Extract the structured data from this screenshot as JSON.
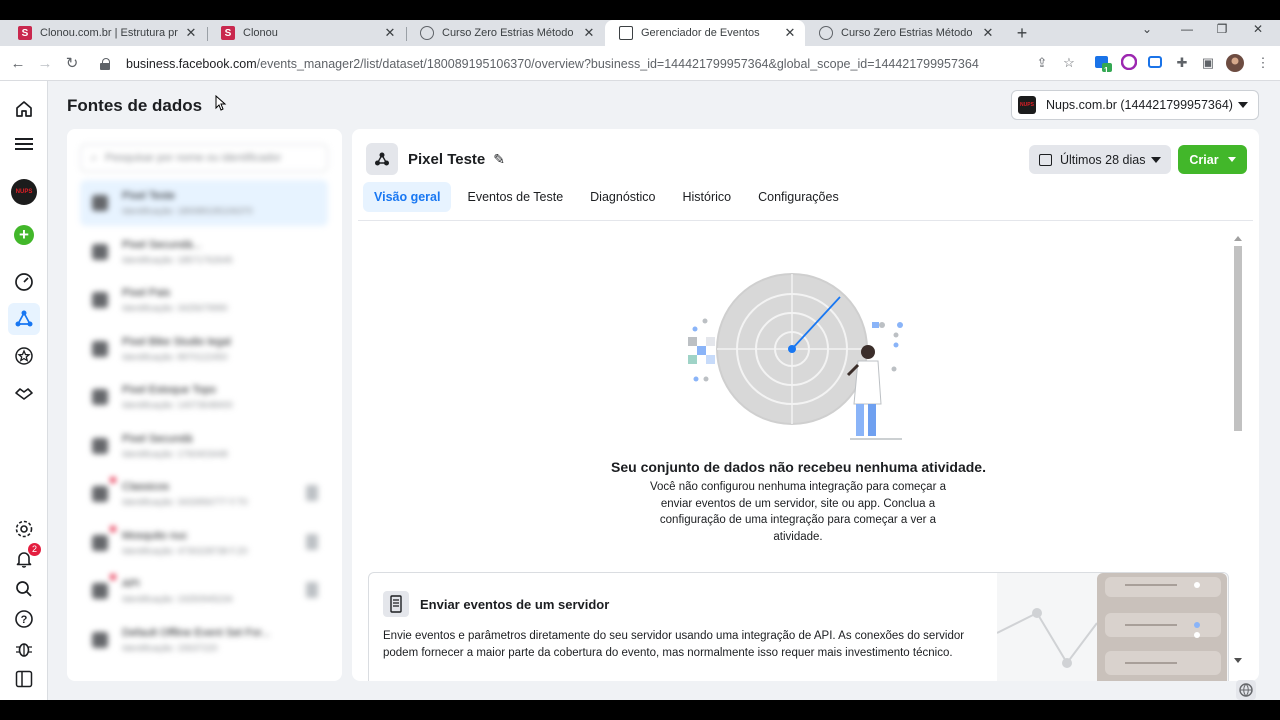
{
  "browser": {
    "tabs": [
      {
        "title": "Clonou.com.br | Estrutura própria",
        "icon": "clonou-favicon"
      },
      {
        "title": "Clonou",
        "icon": "clonou-favicon"
      },
      {
        "title": "Curso Zero Estrias Método Ameri",
        "icon": "globe-icon"
      },
      {
        "title": "Gerenciador de Eventos",
        "icon": "facebook-favicon"
      },
      {
        "title": "Curso Zero Estrias Método Ameri",
        "icon": "globe-icon"
      }
    ],
    "url_host": "business.facebook.com",
    "url_path": "/events_manager2/list/dataset/180089195106370/overview?business_id=144421799957364&global_scope_id=144421799957364",
    "extension_badge": "1"
  },
  "header": {
    "page_title": "Fontes de dados",
    "account": "Nups.com.br (144421799957364)",
    "account_logo_text": "NUPS"
  },
  "sidebar": {
    "notifications_count": "2",
    "logo_text": "NUPS"
  },
  "sources": {
    "search_placeholder": "Pesquisar por nome ou identificador",
    "items": [
      {
        "name": "Pixel Teste",
        "sub": "Identificação: 180089195106370"
      },
      {
        "name": "Pixel Secundá...",
        "sub": "Identificação: 18571762645"
      },
      {
        "name": "Pixel Pais",
        "sub": "Identificação: 3425679990"
      },
      {
        "name": "Pixel Bike Studio legal",
        "sub": "Identificação: 8970122450"
      },
      {
        "name": "Pixel Estoque Topo",
        "sub": "Identificação: 14073648400"
      },
      {
        "name": "Pixel Secundá",
        "sub": "Identificação: 1760403448"
      },
      {
        "name": "Classicos",
        "sub": "Identificação: 3433956777 F.T0"
      },
      {
        "name": "Mosquito nuc",
        "sub": "Identificação: 4730228738 F.Z0"
      },
      {
        "name": "API",
        "sub": "Identificação: 19250945234"
      },
      {
        "name": "Default Offline Event Set For...",
        "sub": "Identificação: 15637220"
      }
    ]
  },
  "main": {
    "pixel_name": "Pixel Teste",
    "date_range": "Últimos 28 dias",
    "create_label": "Criar",
    "tabs": [
      "Visão geral",
      "Eventos de Teste",
      "Diagnóstico",
      "Histórico",
      "Configurações"
    ],
    "empty_title": "Seu conjunto de dados não recebeu nenhuma atividade.",
    "empty_desc": "Você não configurou nenhuma integração para começar a enviar eventos de um servidor, site ou app. Conclua a configuração de uma integração para começar a ver a atividade.",
    "server_title": "Enviar eventos de um servidor",
    "server_desc": "Envie eventos e parâmetros diretamente do seu servidor usando uma integração de API. As conexões do servidor podem fornecer a maior parte da cobertura do evento, mas normalmente isso requer mais investimento técnico."
  },
  "colors": {
    "accent": "#1877f2",
    "create_green": "#42b72a",
    "page_bg": "#f0f2f5"
  }
}
